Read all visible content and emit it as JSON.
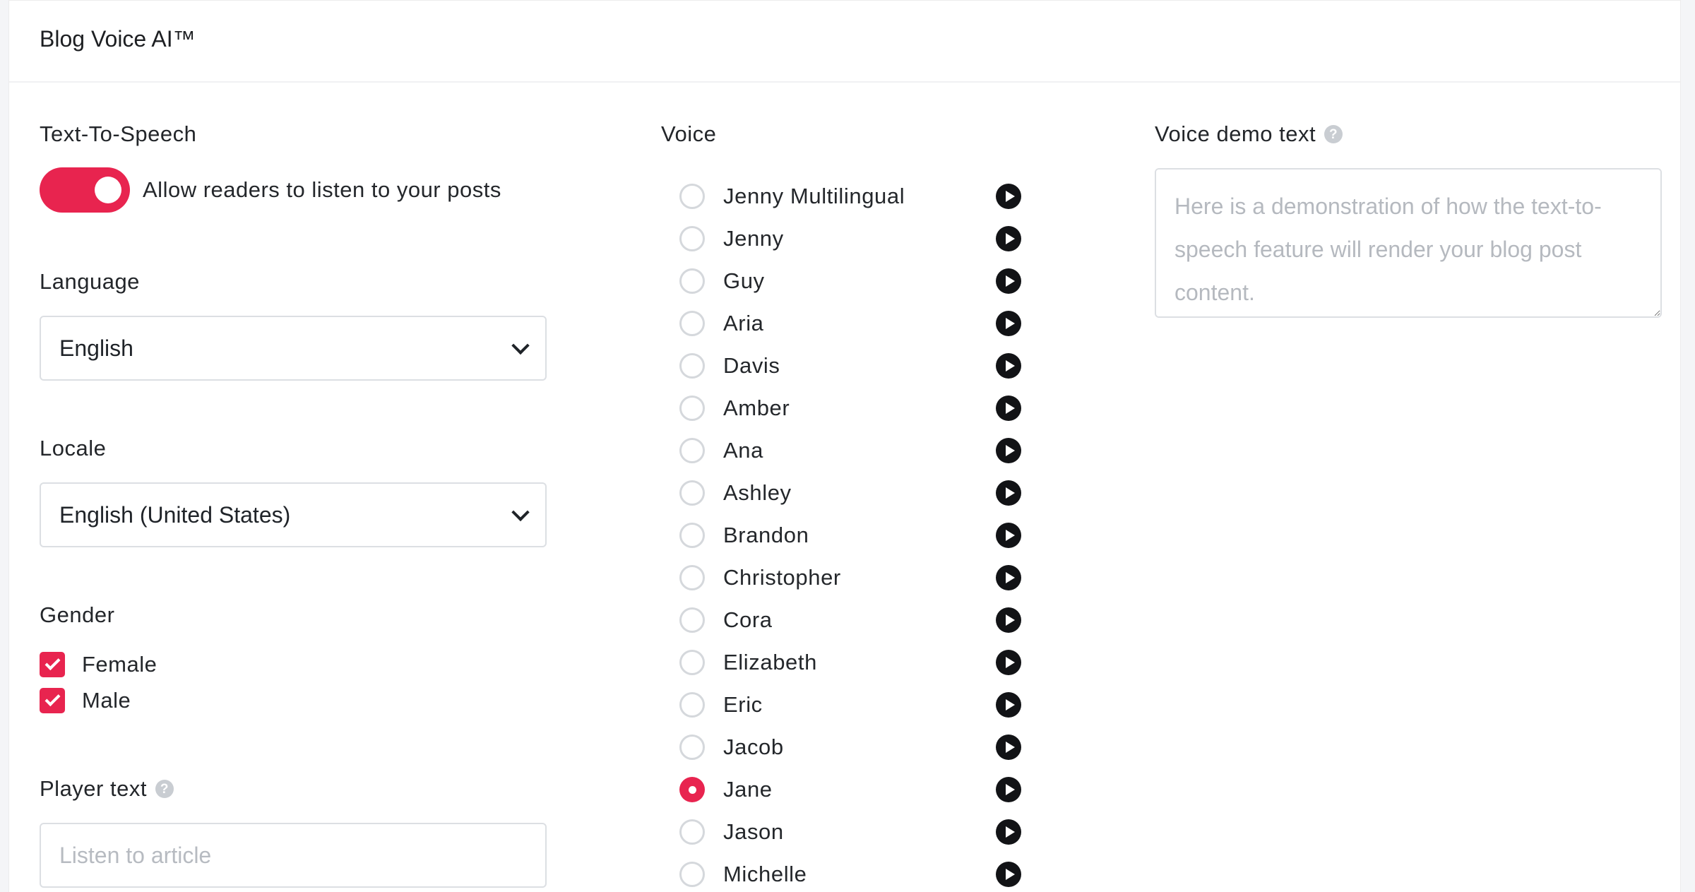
{
  "header": {
    "title": "Blog Voice AI™"
  },
  "tts": {
    "label": "Text-To-Speech",
    "toggle_label": "Allow readers to listen to your posts",
    "enabled": true
  },
  "language": {
    "label": "Language",
    "value": "English"
  },
  "locale": {
    "label": "Locale",
    "value": "English (United States)"
  },
  "gender": {
    "label": "Gender",
    "options": [
      {
        "label": "Female",
        "checked": true
      },
      {
        "label": "Male",
        "checked": true
      }
    ]
  },
  "player_text": {
    "label": "Player text",
    "placeholder": "Listen to article",
    "help_icon": "question-circle-icon"
  },
  "voice": {
    "label": "Voice",
    "selected": "Jane",
    "items": [
      "Jenny Multilingual",
      "Jenny",
      "Guy",
      "Aria",
      "Davis",
      "Amber",
      "Ana",
      "Ashley",
      "Brandon",
      "Christopher",
      "Cora",
      "Elizabeth",
      "Eric",
      "Jacob",
      "Jane",
      "Jason",
      "Michelle"
    ]
  },
  "demo_text": {
    "label": "Voice demo text",
    "help_icon": "question-circle-icon",
    "placeholder": "Here is a demonstration of how the text-to-speech feature will render your blog post content."
  },
  "colors": {
    "accent": "#e8244f",
    "play": "#121316",
    "border": "#dcdfe3"
  }
}
